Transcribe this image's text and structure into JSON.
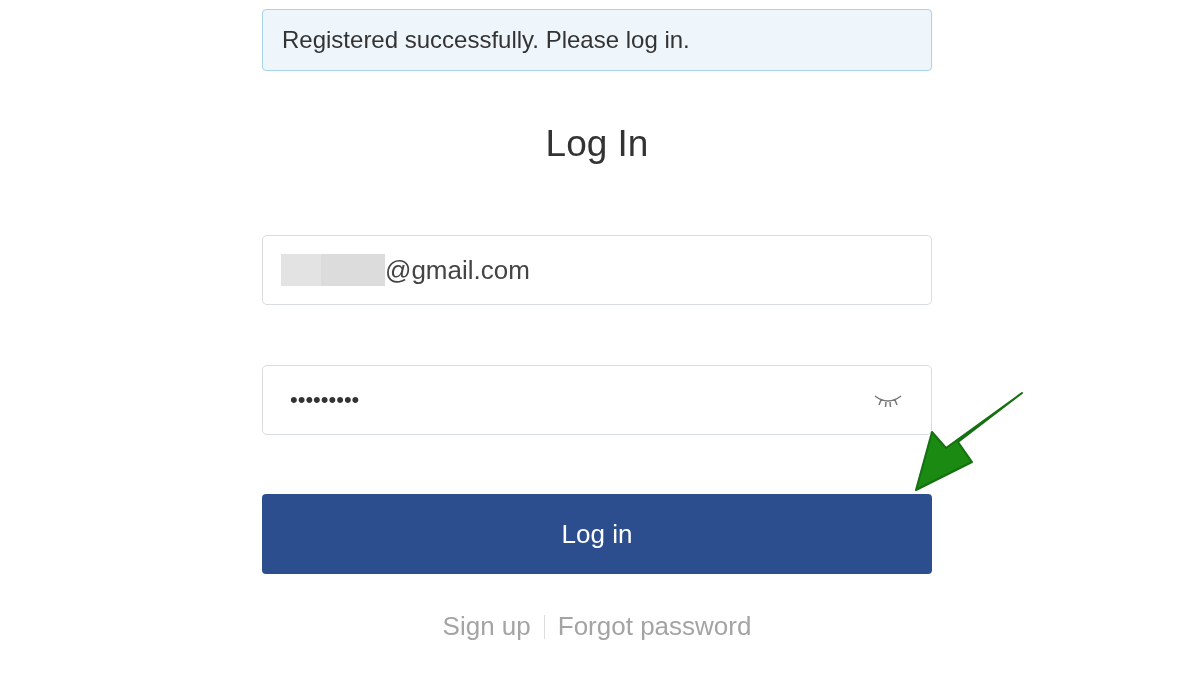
{
  "alert": {
    "message": "Registered successfully. Please log in."
  },
  "title": "Log In",
  "email_field": {
    "value": "@gmail.com",
    "redacted": true
  },
  "password_field": {
    "value": "•••••••••",
    "reveal": false
  },
  "login_button": {
    "label": "Log in"
  },
  "links": [
    {
      "label": "Sign up"
    },
    {
      "label": "Forgot password"
    }
  ],
  "annotation": {
    "kind": "arrow"
  }
}
